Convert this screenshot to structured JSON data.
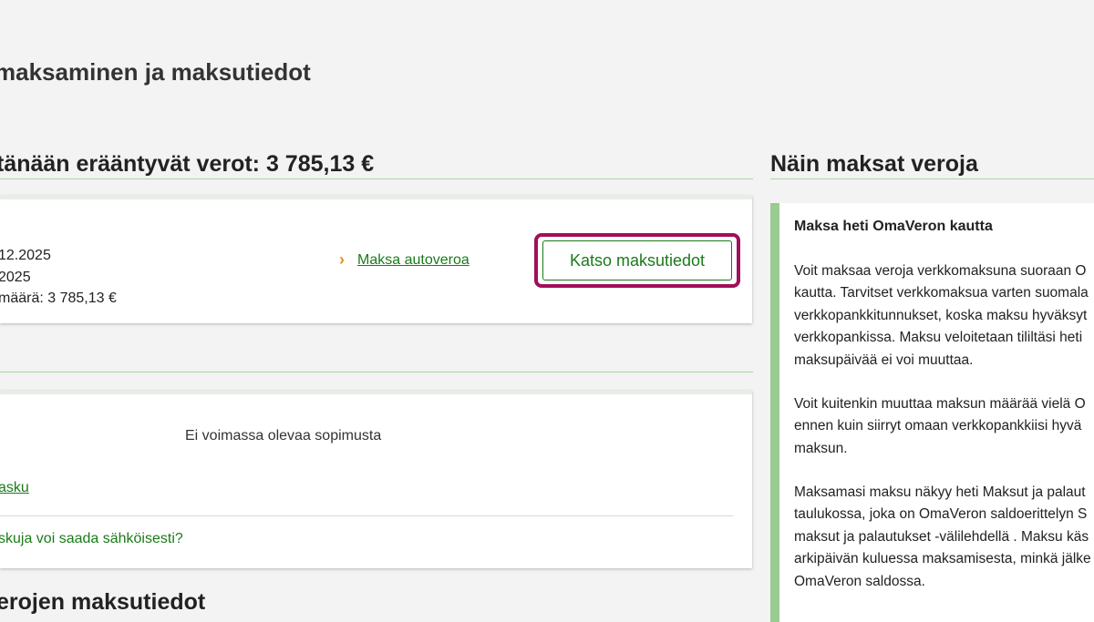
{
  "page": {
    "title": "maksaminen ja maksutiedot"
  },
  "due_section": {
    "title": "tänään erääntyvät verot: 3 785,13 €",
    "card": {
      "line1": "12.2025",
      "line2": "2025",
      "line3": "määrä: 3 785,13 €",
      "pay_link": "Maksa autoveroa",
      "pay_link_icon": "chevron-right-icon",
      "details_button": "Katso maksutiedot"
    }
  },
  "agreement_card": {
    "no_agreement_text": "Ei voimassa olevaa sopimusta",
    "link_label": "asku",
    "question_link": "skuja voi saada sähköisesti?"
  },
  "bottom_section": {
    "title": "erojen maksutiedot"
  },
  "side": {
    "title": "Näin maksat veroja",
    "panel_heading": "Maksa heti OmaVeron kautta",
    "paragraphs": [
      [
        "Voit maksaa veroja verkkomaksuna suoraan O",
        "kautta. Tarvitset verkkomaksua varten suomala",
        "verkkopankkitunnukset, koska maksu hyväksyt",
        "verkkopankissa. Maksu veloitetaan tililtäsi heti",
        "maksupäivää ei voi muuttaa."
      ],
      [
        "Voit kuitenkin muuttaa maksun määrää vielä O",
        "ennen kuin siirryt omaan verkkopankkiisi hyvä",
        "maksun."
      ],
      [
        "Maksamasi maksu näkyy heti Maksut ja palaut",
        "taulukossa, joka on OmaVeron saldoerittelyn S",
        "maksut ja palautukset -välilehdellä . Maksu käs",
        "arkipäivän kuluessa maksamisesta, minkä jälke",
        "OmaVeron saldossa."
      ]
    ]
  },
  "colors": {
    "page_bg": "#f3f3f3",
    "green_text": "#1b7a1b",
    "green_rule": "#a9d3a2",
    "panel_accent": "#9acb91",
    "highlight": "#a0105a",
    "chevron": "#f08a1c"
  }
}
